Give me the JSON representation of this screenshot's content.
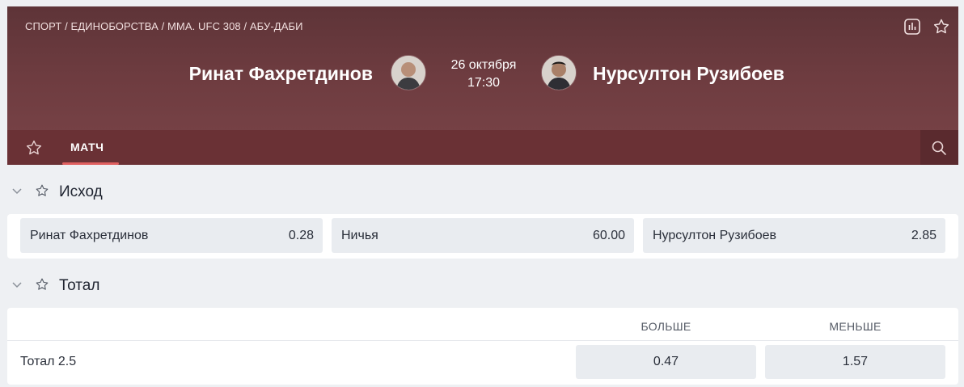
{
  "header": {
    "breadcrumb": "СПОРТ / ЕДИНОБОРСТВА / MMA. UFC 308 / АБУ-ДАБИ",
    "team_home": "Ринат Фахретдинов",
    "team_away": "Нурсултон Рузибоев",
    "date": "26 октября",
    "time": "17:30",
    "icons": [
      "stats-icon",
      "star-icon"
    ]
  },
  "tabs": [
    {
      "label": "МАТЧ",
      "active": true
    }
  ],
  "markets": {
    "outcome": {
      "title": "Исход",
      "options": [
        {
          "label": "Ринат Фахретдинов",
          "odds": "0.28"
        },
        {
          "label": "Ничья",
          "odds": "60.00"
        },
        {
          "label": "Нурсултон Рузибоев",
          "odds": "2.85"
        }
      ]
    },
    "total": {
      "title": "Тотал",
      "columns": [
        "БОЛЬШЕ",
        "МЕНЬШЕ"
      ],
      "rows": [
        {
          "label": "Тотал 2.5",
          "over": "0.47",
          "under": "1.57"
        }
      ]
    }
  },
  "colors": {
    "header_bg": "#6e3c40",
    "tabbar_bg": "#6a3135",
    "active_tab_underline": "#e06060",
    "odds_bg": "#e9ecf0"
  }
}
